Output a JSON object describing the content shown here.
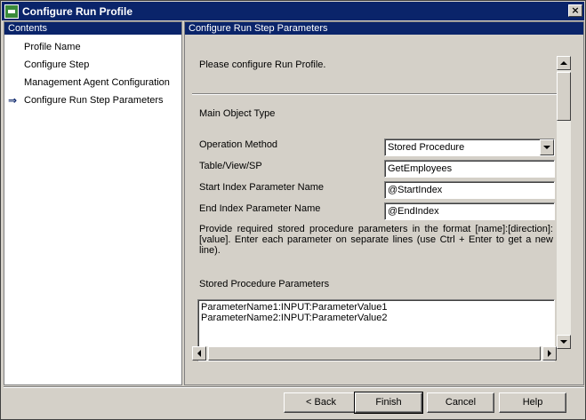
{
  "window": {
    "title": "Configure Run Profile",
    "close_label": "×"
  },
  "left_pane": {
    "header": "Contents",
    "items": [
      {
        "label": "Profile Name"
      },
      {
        "label": "Configure Step"
      },
      {
        "label": "Management Agent Configuration"
      },
      {
        "label": "Configure Run Step Parameters"
      }
    ],
    "current_arrow": "⇒"
  },
  "right_pane": {
    "header": "Configure Run Step Parameters",
    "intro": "Please configure Run Profile.",
    "main_object_type_label": "Main Object Type",
    "operation_method": {
      "label": "Operation Method",
      "value": "Stored Procedure"
    },
    "table_view_sp": {
      "label": "Table/View/SP",
      "value": "GetEmployees"
    },
    "start_index": {
      "label": "Start Index Parameter Name",
      "value": "@StartIndex"
    },
    "end_index": {
      "label": "End Index Parameter Name",
      "value": "@EndIndex"
    },
    "instructions": "Provide required stored procedure parameters in the format [name]:[direction]:[value]. Enter each parameter on separate lines (use Ctrl + Enter to get a new line).",
    "stored_proc_params": {
      "label": "Stored  Procedure Parameters",
      "lines": [
        "ParameterName1:INPUT:ParameterValue1",
        "ParameterName2:INPUT:ParameterValue2"
      ]
    }
  },
  "buttons": {
    "back": "< Back",
    "finish": "Finish",
    "cancel": "Cancel",
    "help": "Help"
  },
  "colors": {
    "titlebar": "#0a246a",
    "face": "#d4d0c8",
    "header_text": "#ffffff"
  }
}
